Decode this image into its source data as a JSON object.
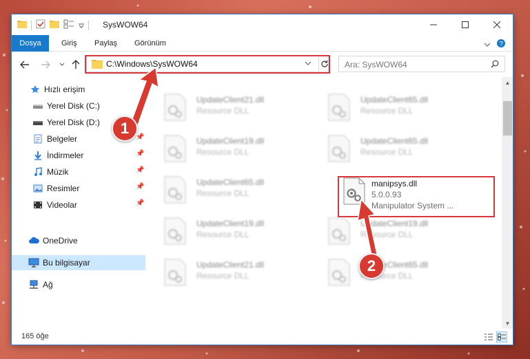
{
  "window": {
    "title": "SysWOW64"
  },
  "ribbon": {
    "tabs": [
      "Dosya",
      "Giriş",
      "Paylaş",
      "Görünüm"
    ]
  },
  "address": {
    "path": "C:\\Windows\\SysWOW64"
  },
  "search": {
    "placeholder": "Ara: SysWOW64"
  },
  "navpane": {
    "items": [
      {
        "label": "Hızlı erişim",
        "icon": "star-icon"
      },
      {
        "label": "Yerel Disk (C:)",
        "icon": "drive-icon"
      },
      {
        "label": "Yerel Disk (D:)",
        "icon": "drive-icon"
      },
      {
        "label": "Belgeler",
        "icon": "documents-icon"
      },
      {
        "label": "İndirmeler",
        "icon": "download-icon"
      },
      {
        "label": "Müzik",
        "icon": "music-icon"
      },
      {
        "label": "Resimler",
        "icon": "pictures-icon"
      },
      {
        "label": "Videolar",
        "icon": "videos-icon"
      },
      {
        "label": "OneDrive",
        "icon": "cloud-icon"
      },
      {
        "label": "Bu bilgisayar",
        "icon": "computer-icon"
      },
      {
        "label": "Ağ",
        "icon": "network-icon"
      }
    ]
  },
  "files": {
    "blurred": [
      {
        "name": "UpdateClient21.dll",
        "desc": "Resource DLL"
      },
      {
        "name": "UpdateClient65.dll",
        "desc": "Resource DLL"
      },
      {
        "name": "UpdateClient19.dll",
        "desc": "Resource DLL"
      },
      {
        "name": "UpdateClient65.dll",
        "desc": "Resource DLL"
      },
      {
        "name": "UpdateClient65.dll",
        "desc": "Resource DLL"
      },
      {
        "name": "UpdateClient19.dll",
        "desc": "Resource DLL"
      },
      {
        "name": "UpdateClient19.dll",
        "desc": "Resource DLL"
      },
      {
        "name": "UpdateClient21.dll",
        "desc": "Resource DLL"
      },
      {
        "name": "UpdateClient65.dll",
        "desc": "Resource DLL"
      }
    ],
    "focused": {
      "name": "manipsys.dll",
      "version": "5.0.0.93",
      "desc": "Manipulator System ..."
    }
  },
  "status": {
    "count": "165 öğe"
  },
  "annotations": {
    "step1": "1",
    "step2": "2",
    "color": "#d83a32"
  }
}
